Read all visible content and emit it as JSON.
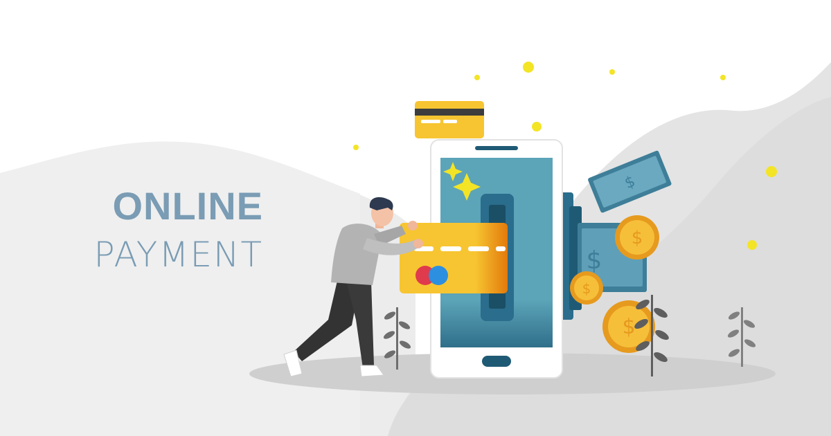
{
  "banner": {
    "title_line1": "ONLINE",
    "title_line2": "PAYMENT",
    "title_color": "#7a9cb4"
  },
  "illustration": {
    "currency_symbol": "$",
    "colors": {
      "background_blob": "#e6e6e6",
      "ground_shadow": "#d6d6d6",
      "phone_body": "#ffffff",
      "phone_screen": "#5ca4b8",
      "card_yellow": "#f7c531",
      "card_orange": "#e8870f",
      "banknote": "#4f8faa",
      "coin": "#f2b232",
      "sparkle": "#f3e426",
      "person_shirt": "#b3b3b3",
      "person_pants": "#3a3a3a",
      "person_hair": "#2d3a4f",
      "plant": "#7a7a7a"
    },
    "icons": [
      "person-icon",
      "smartphone-icon",
      "credit-card-icon",
      "banknote-icon",
      "coin-icon",
      "sparkle-icon",
      "plant-icon"
    ]
  }
}
